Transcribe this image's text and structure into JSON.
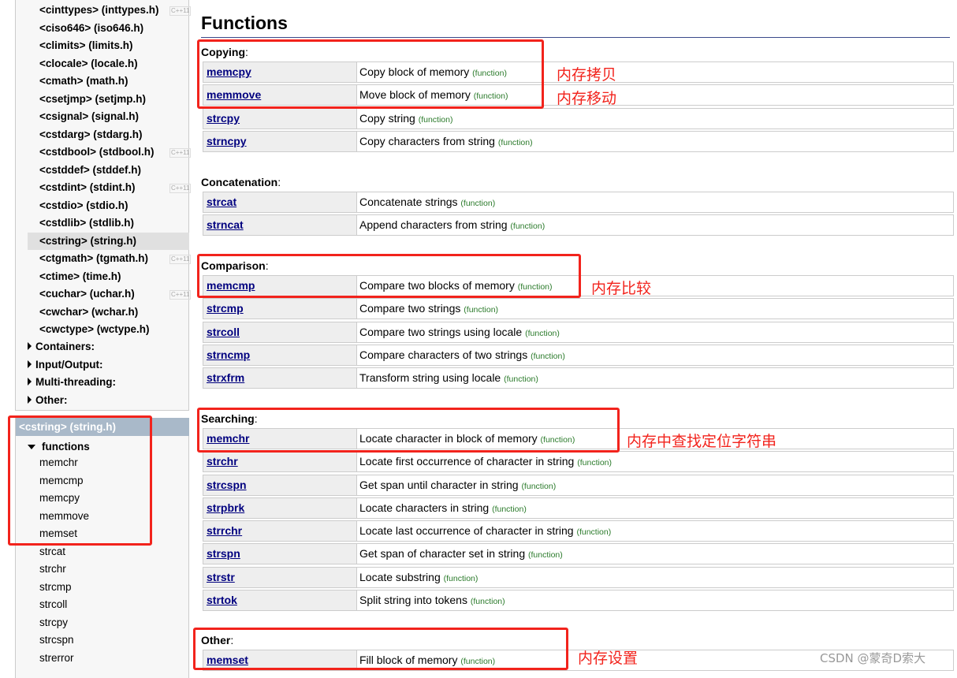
{
  "sidebar": {
    "headers": [
      {
        "label": "<cinttypes> (inttypes.h)",
        "badge": "C++11"
      },
      {
        "label": "<ciso646> (iso646.h)"
      },
      {
        "label": "<climits> (limits.h)"
      },
      {
        "label": "<clocale> (locale.h)"
      },
      {
        "label": "<cmath> (math.h)"
      },
      {
        "label": "<csetjmp> (setjmp.h)"
      },
      {
        "label": "<csignal> (signal.h)"
      },
      {
        "label": "<cstdarg> (stdarg.h)"
      },
      {
        "label": "<cstdbool> (stdbool.h)",
        "badge": "C++11"
      },
      {
        "label": "<cstddef> (stddef.h)"
      },
      {
        "label": "<cstdint> (stdint.h)",
        "badge": "C++11"
      },
      {
        "label": "<cstdio> (stdio.h)"
      },
      {
        "label": "<cstdlib> (stdlib.h)"
      },
      {
        "label": "<cstring> (string.h)"
      },
      {
        "label": "<ctgmath> (tgmath.h)",
        "badge": "C++11"
      },
      {
        "label": "<ctime> (time.h)"
      },
      {
        "label": "<cuchar> (uchar.h)",
        "badge": "C++11"
      },
      {
        "label": "<cwchar> (wchar.h)"
      },
      {
        "label": "<cwctype> (wctype.h)"
      }
    ],
    "groups": [
      "Containers:",
      "Input/Output:",
      "Multi-threading:",
      "Other:"
    ],
    "current": {
      "title": "<cstring> (string.h)",
      "section": "functions",
      "items": [
        "memchr",
        "memcmp",
        "memcpy",
        "memmove",
        "memset",
        "strcat",
        "strchr",
        "strcmp",
        "strcoll",
        "strcpy",
        "strcspn",
        "strerror"
      ]
    }
  },
  "main": {
    "title": "Functions",
    "type_label": "(function)",
    "sections": [
      {
        "label": "Copying",
        "rows": [
          [
            "memcpy",
            "Copy block of memory"
          ],
          [
            "memmove",
            "Move block of memory"
          ],
          [
            "strcpy",
            "Copy string"
          ],
          [
            "strncpy",
            "Copy characters from string"
          ]
        ]
      },
      {
        "label": "Concatenation",
        "rows": [
          [
            "strcat",
            "Concatenate strings"
          ],
          [
            "strncat",
            "Append characters from string"
          ]
        ]
      },
      {
        "label": "Comparison",
        "rows": [
          [
            "memcmp",
            "Compare two blocks of memory"
          ],
          [
            "strcmp",
            "Compare two strings"
          ],
          [
            "strcoll",
            "Compare two strings using locale"
          ],
          [
            "strncmp",
            "Compare characters of two strings"
          ],
          [
            "strxfrm",
            "Transform string using locale"
          ]
        ]
      },
      {
        "label": "Searching",
        "rows": [
          [
            "memchr",
            "Locate character in block of memory"
          ],
          [
            "strchr",
            "Locate first occurrence of character in string"
          ],
          [
            "strcspn",
            "Get span until character in string"
          ],
          [
            "strpbrk",
            "Locate characters in string"
          ],
          [
            "strrchr",
            "Locate last occurrence of character in string"
          ],
          [
            "strspn",
            "Get span of character set in string"
          ],
          [
            "strstr",
            "Locate substring"
          ],
          [
            "strtok",
            "Split string into tokens"
          ]
        ]
      },
      {
        "label": "Other",
        "rows": [
          [
            "memset",
            "Fill block of memory"
          ]
        ]
      }
    ]
  },
  "annotations": {
    "copy": "内存拷贝",
    "move": "内存移动",
    "compare": "内存比较",
    "search": "内存中查找定位字符串",
    "set": "内存设置"
  },
  "watermark": "CSDN @蒙奇D索大"
}
